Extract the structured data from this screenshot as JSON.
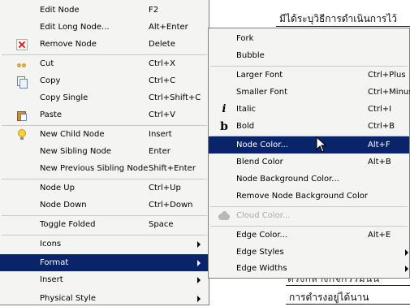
{
  "background": {
    "node_text_top": "มีได้ระบุวิธีการดำเนินการไว้",
    "node_text_partial": "ตรงกลางกิจกรรมนั้น",
    "node_text_bottom": "การดำรงอยู่ได้นาน"
  },
  "context_menu": {
    "items": [
      {
        "label": "Edit Node",
        "shortcut": "F2",
        "icon": ""
      },
      {
        "label": "Edit Long Node...",
        "shortcut": "Alt+Enter",
        "icon": ""
      },
      {
        "label": "Remove Node",
        "shortcut": "Delete",
        "icon": "remove-x-icon"
      },
      {
        "label": "Cut",
        "shortcut": "Ctrl+X",
        "icon": "scissors-icon"
      },
      {
        "label": "Copy",
        "shortcut": "Ctrl+C",
        "icon": "copy-icon"
      },
      {
        "label": "Copy Single",
        "shortcut": "Ctrl+Shift+C",
        "icon": ""
      },
      {
        "label": "Paste",
        "shortcut": "Ctrl+V",
        "icon": "paste-icon"
      },
      {
        "label": "New Child Node",
        "shortcut": "Insert",
        "icon": "lightbulb-icon"
      },
      {
        "label": "New Sibling Node",
        "shortcut": "Enter",
        "icon": ""
      },
      {
        "label": "New Previous Sibling Node",
        "shortcut": "Shift+Enter",
        "icon": ""
      },
      {
        "label": "Node Up",
        "shortcut": "Ctrl+Up",
        "icon": ""
      },
      {
        "label": "Node Down",
        "shortcut": "Ctrl+Down",
        "icon": ""
      },
      {
        "label": "Toggle Folded",
        "shortcut": "Space",
        "icon": ""
      },
      {
        "label": "Icons",
        "shortcut": "",
        "submenu": true
      },
      {
        "label": "Format",
        "shortcut": "",
        "submenu": true,
        "highlighted": true
      },
      {
        "label": "Insert",
        "shortcut": "",
        "submenu": true
      },
      {
        "label": "Physical Style",
        "shortcut": "",
        "submenu": true
      }
    ]
  },
  "format_submenu": {
    "items": [
      {
        "label": "Fork",
        "shortcut": ""
      },
      {
        "label": "Bubble",
        "shortcut": ""
      },
      {
        "label": "Larger Font",
        "shortcut": "Ctrl+Plus"
      },
      {
        "label": "Smaller Font",
        "shortcut": "Ctrl+Minus"
      },
      {
        "label": "Italic",
        "shortcut": "Ctrl+I",
        "icon": "italic-icon",
        "glyph": "i"
      },
      {
        "label": "Bold",
        "shortcut": "Ctrl+B",
        "icon": "bold-icon",
        "glyph": "b"
      },
      {
        "label": "Node Color...",
        "shortcut": "Alt+F",
        "highlighted": true
      },
      {
        "label": "Blend Color",
        "shortcut": "Alt+B"
      },
      {
        "label": "Node Background Color...",
        "shortcut": ""
      },
      {
        "label": "Remove Node Background Color",
        "shortcut": ""
      },
      {
        "label": "Cloud Color...",
        "shortcut": "",
        "icon": "cloud-icon",
        "disabled": true
      },
      {
        "label": "Edge Color...",
        "shortcut": "Alt+E"
      },
      {
        "label": "Edge Styles",
        "shortcut": "",
        "submenu": true
      },
      {
        "label": "Edge Widths",
        "shortcut": "",
        "submenu": true
      }
    ]
  },
  "colors": {
    "menu_bg": "#f4f4f2",
    "highlight_bg": "#0a246a",
    "highlight_fg": "#ffffff",
    "disabled_fg": "#a8a8a8"
  }
}
